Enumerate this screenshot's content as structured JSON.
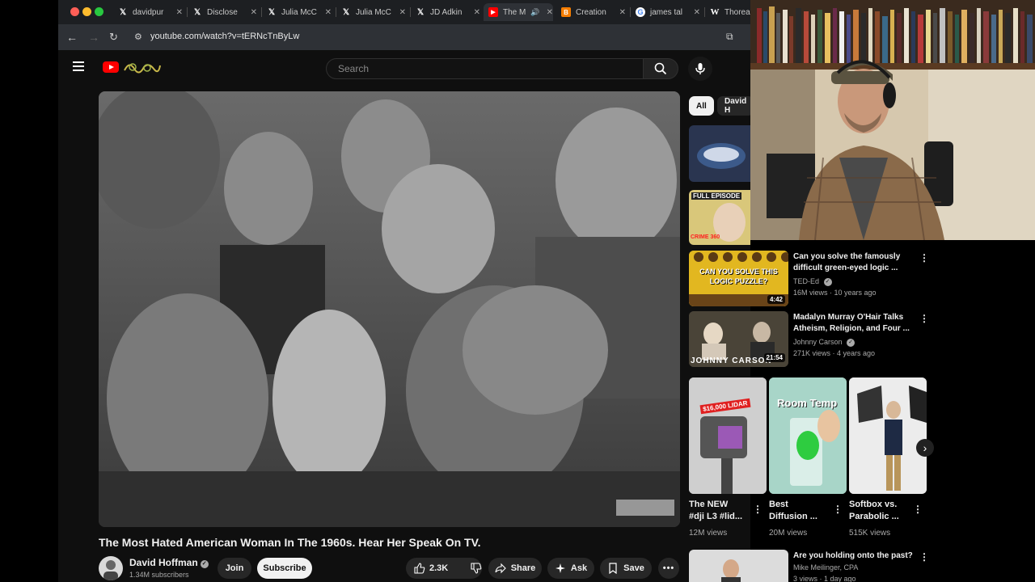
{
  "browser": {
    "tabs": [
      {
        "title": "davidpur",
        "icon": "x-logo"
      },
      {
        "title": "Disclose",
        "icon": "x-logo"
      },
      {
        "title": "Julia McC",
        "icon": "x-logo"
      },
      {
        "title": "Julia McC",
        "icon": "x-logo"
      },
      {
        "title": "JD Adkin",
        "icon": "x-logo"
      },
      {
        "title": "The M",
        "icon": "youtube-logo",
        "active": true
      },
      {
        "title": "Creation",
        "icon": "blogger-logo"
      },
      {
        "title": "james tal",
        "icon": "google-logo"
      },
      {
        "title": "Thorea",
        "icon": "wikipedia-logo"
      }
    ],
    "url": "youtube.com/watch?v=tERNcTnByLw"
  },
  "youtube": {
    "search_placeholder": "Search",
    "video": {
      "title": "The Most Hated American Woman In The 1960s. Hear Her Speak On TV.",
      "channel": "David Hoffman",
      "subscribers": "1.34M subscribers",
      "join_label": "Join",
      "subscribe_label": "Subscribe",
      "likes": "2.3K",
      "share_label": "Share",
      "ask_label": "Ask",
      "save_label": "Save"
    },
    "chips": [
      {
        "label": "All"
      },
      {
        "label": "David H"
      }
    ],
    "related": [
      {
        "title_line1": "Can you solve the famously",
        "title_line2": "difficult green-eyed logic ...",
        "channel": "TED-Ed",
        "meta": "16M views · 10 years ago",
        "duration": "4:42",
        "thumb_text1": "CAN YOU SOLVE THIS",
        "thumb_text2": "LOGIC PUZZLE?"
      },
      {
        "title_line1": "Madalyn Murray O'Hair Talks",
        "title_line2": "Atheism, Religion, and Four ...",
        "channel": "Johnny Carson",
        "meta": "271K views · 4 years ago",
        "duration": "21:54",
        "thumb_text1": "JOHNNY CARSON"
      },
      {
        "title_line1": "Are you holding onto the past?",
        "channel": "Mike Meilinger, CPA",
        "meta": "3 views · 1 day ago"
      }
    ],
    "partial_thumb": {
      "label": "FULL EPISODE",
      "label2": "CRIME 360"
    },
    "shorts": [
      {
        "title_line1": "The NEW",
        "title_line2": "#dji L3 #lid...",
        "views": "12M views",
        "thumb_text": "$16,000 LIDAR"
      },
      {
        "title_line1": "Best",
        "title_line2": "Diffusion ...",
        "views": "20M views",
        "thumb_text": "Room Temp"
      },
      {
        "title_line1": "Softbox vs.",
        "title_line2": "Parabolic ...",
        "views": "515K views"
      }
    ]
  }
}
